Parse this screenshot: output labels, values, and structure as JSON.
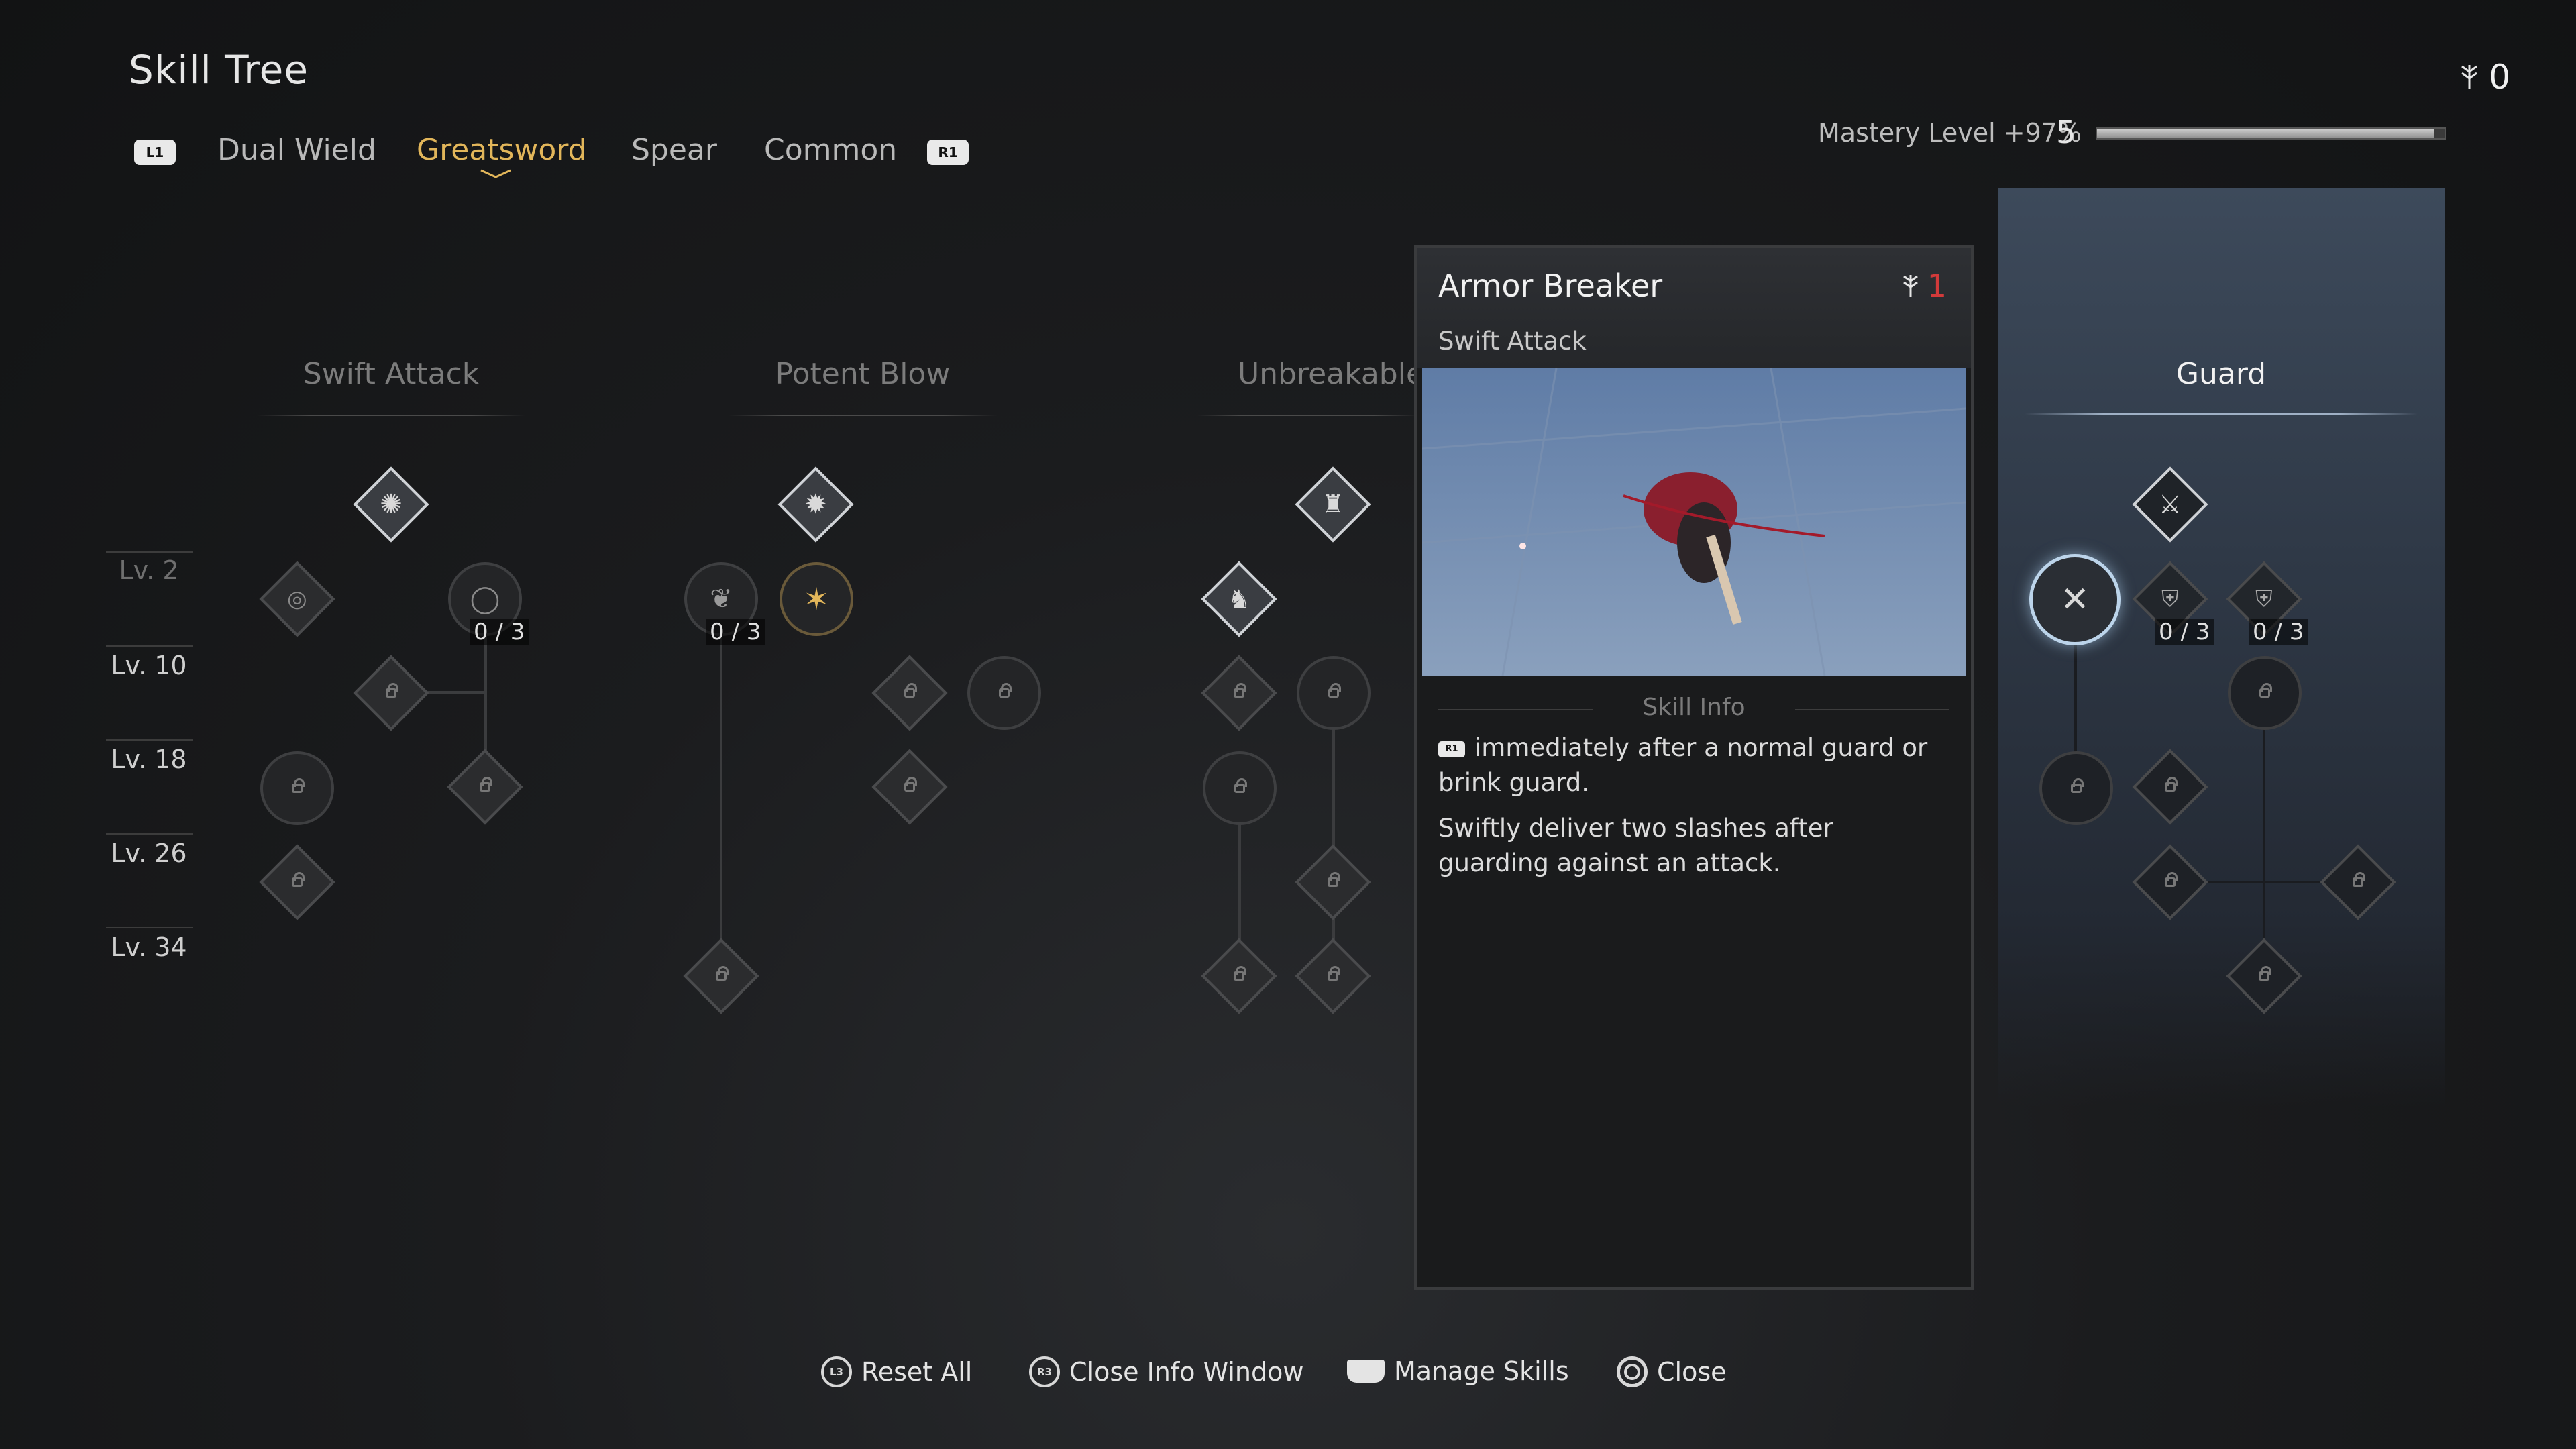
{
  "header": {
    "title": "Skill Tree",
    "points": "0",
    "mastery_label": "Mastery Level +97%",
    "mastery_level": "5",
    "mastery_progress": 0.97,
    "left_bumper": "L1",
    "right_bumper": "R1",
    "tabs": [
      {
        "label": "Dual Wield",
        "active": false
      },
      {
        "label": "Greatsword",
        "active": true
      },
      {
        "label": "Spear",
        "active": false
      },
      {
        "label": "Common",
        "active": false
      }
    ]
  },
  "levels": [
    "Lv. 2",
    "Lv. 10",
    "Lv. 18",
    "Lv. 26",
    "Lv. 34"
  ],
  "columns": {
    "swift_attack": "Swift Attack",
    "potent_blow": "Potent Blow",
    "unbreakable": "Unbreakable",
    "guard": "Guard"
  },
  "counters": {
    "swift": "0 / 3",
    "potent": "0 / 3",
    "guard_a": "0 / 3",
    "guard_b": "0 / 3"
  },
  "info": {
    "title": "Armor Breaker",
    "subtitle": "Swift Attack",
    "cost": "1",
    "section_label": "Skill Info",
    "input_glyph": "R1",
    "text_1": "immediately after a normal guard or brink guard.",
    "text_2": "Swiftly deliver two slashes after guarding against an attack."
  },
  "footer": {
    "reset": {
      "glyph": "L3",
      "label": "Reset All"
    },
    "close_info": {
      "glyph": "R3",
      "label": "Close Info Window"
    },
    "manage": {
      "label": "Manage Skills"
    },
    "close": {
      "label": "Close"
    }
  },
  "colors": {
    "accent_active_tab": "#e2b65a",
    "cost_red": "#d23a3a",
    "guard_panel": "#3d4a5b"
  }
}
